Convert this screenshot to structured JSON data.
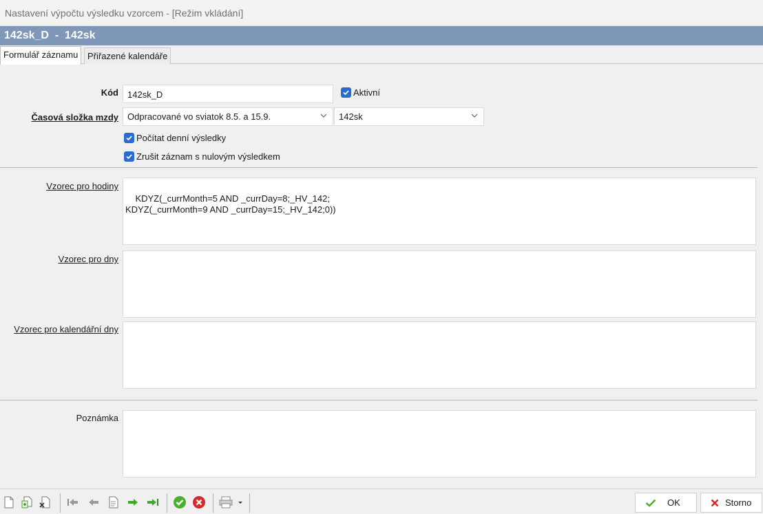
{
  "window": {
    "title": "Nastavení výpočtu výsledku vzorcem - [Režim vkládání]"
  },
  "header": {
    "title": "142sk_D  -  142sk"
  },
  "tabs": [
    {
      "label": "Formulář záznamu",
      "active": true
    },
    {
      "label": "Přiřazené kalendáře",
      "active": false
    }
  ],
  "form": {
    "kod_label": "Kód",
    "kod_value": "142sk_D",
    "aktivni_label": "Aktivní",
    "aktivni_checked": true,
    "casova_label": "Časová složka mzdy",
    "casova_value": "Odpracované vo sviatok 8.5. a 15.9.",
    "casova2_value": "142sk",
    "pocitat_label": "Počítat denní výsledky",
    "pocitat_checked": true,
    "zrusit_label": "Zrušit záznam s nulovým výsledkem",
    "zrusit_checked": true,
    "vzorec_hodiny_label": "Vzorec pro hodiny",
    "vzorec_hodiny_value": "KDYZ(_currMonth=5 AND _currDay=8;_HV_142;\nKDYZ(_currMonth=9 AND _currDay=15;_HV_142;0))",
    "vzorec_dny_label": "Vzorec pro dny",
    "vzorec_dny_value": "",
    "vzorec_kal_label": "Vzorec pro kalendářní dny",
    "vzorec_kal_value": "",
    "poznamka_label": "Poznámka",
    "poznamka_value": ""
  },
  "buttons": {
    "ok": "OK",
    "storno": "Storno"
  },
  "colors": {
    "header_bg": "#7f97b9",
    "checkbox": "#2b6bd0",
    "ok_green": "#4caf2e",
    "storno_red": "#d62b2b"
  }
}
